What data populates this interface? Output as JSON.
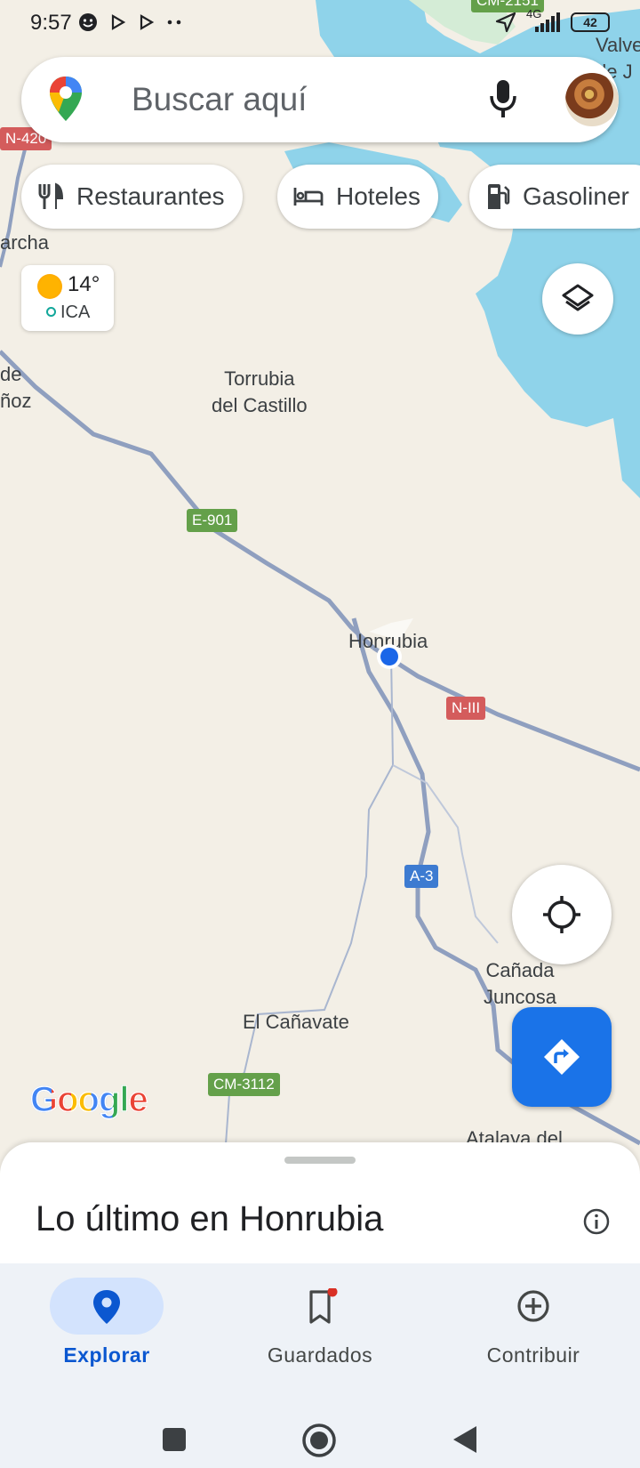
{
  "status_bar": {
    "time": "9:57",
    "network": "4G",
    "battery": "42"
  },
  "search": {
    "placeholder": "Buscar aquí"
  },
  "chips": [
    {
      "label": "Restaurantes",
      "icon": "restaurant-icon"
    },
    {
      "label": "Hoteles",
      "icon": "hotel-icon"
    },
    {
      "label": "Gasoliner",
      "icon": "gas-station-icon"
    }
  ],
  "weather": {
    "temperature": "14°",
    "air_quality_label": "ICA"
  },
  "map": {
    "places": {
      "torrubia": "Torrubia\ndel Castillo",
      "honrubia": "Honrubia",
      "canada": "Cañada\nJuncosa",
      "canavate": "El Cañavate",
      "atalaya": "Atalaya del",
      "valverde": "Valve\nde J",
      "marcha": "archa",
      "munoz": "de\nñoz"
    },
    "roads": {
      "e901": "E-901",
      "n3": "N-III",
      "a3": "A-3",
      "cm3112": "CM-3112",
      "n420": "N-420",
      "cm2151": "CM-2151"
    },
    "colors": {
      "land": "#f3efe6",
      "water": "#8fd3ea",
      "road": "#8f9fbf",
      "green_shield": "#64a04a",
      "red_shield": "#d45c5c",
      "blue_shield": "#3d7bd1"
    }
  },
  "google_logo": "Google",
  "sheet": {
    "title": "Lo último en Honrubia"
  },
  "nav": {
    "items": [
      {
        "label": "Explorar",
        "active": true
      },
      {
        "label": "Guardados",
        "active": false
      },
      {
        "label": "Contribuir",
        "active": false
      }
    ]
  }
}
